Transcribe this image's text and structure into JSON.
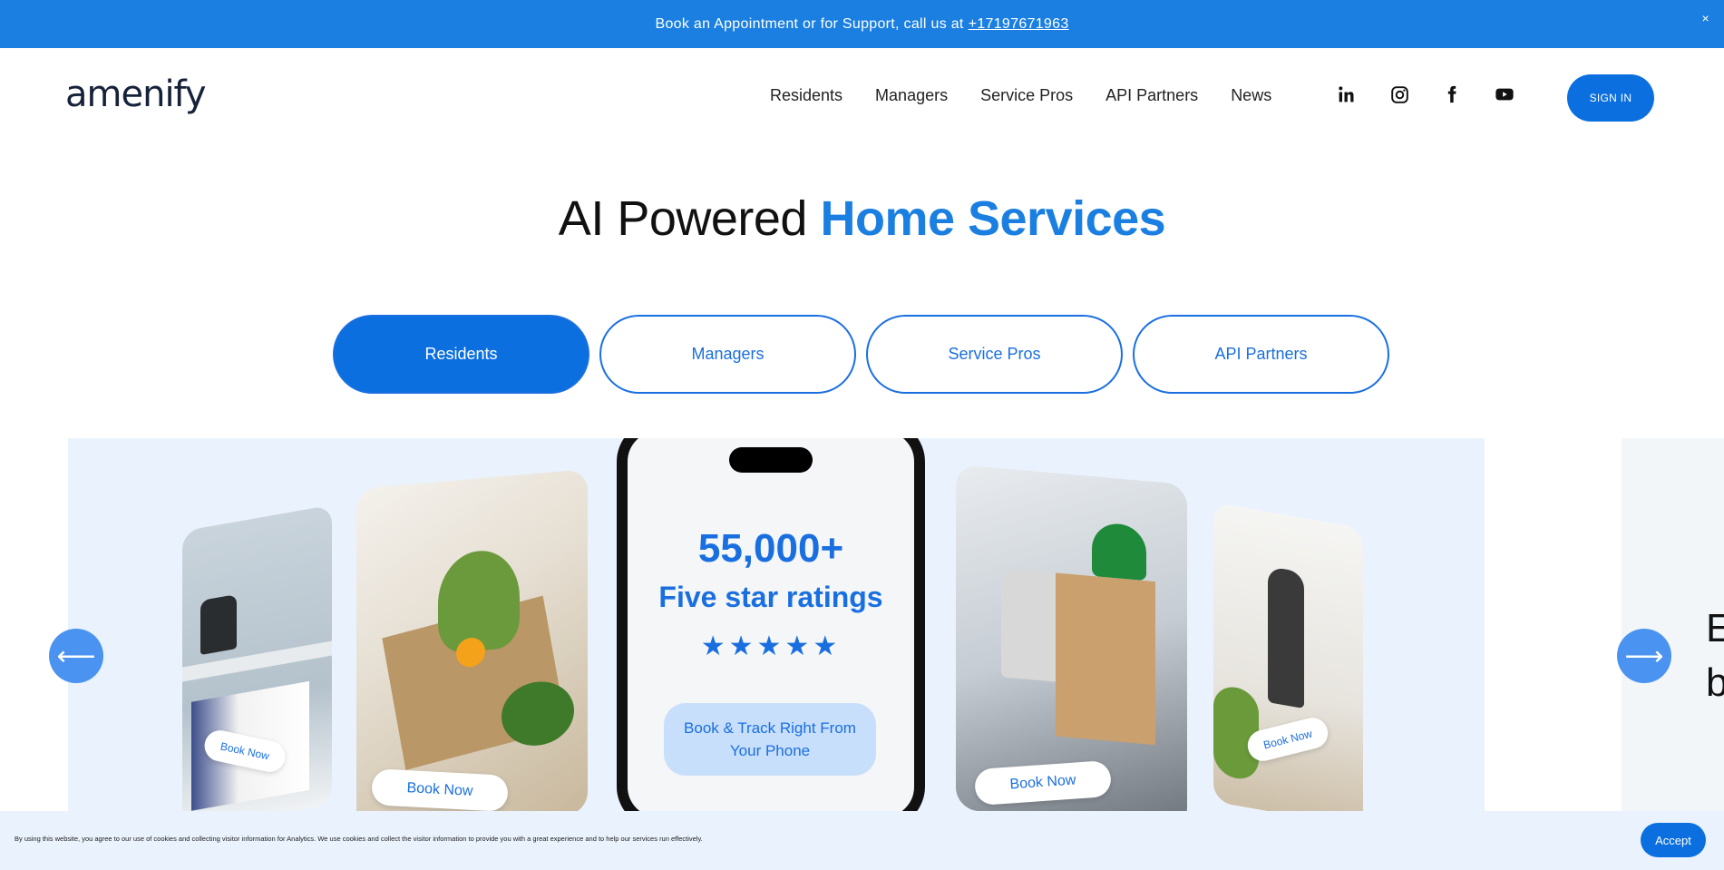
{
  "announcement": {
    "text": "Book an Appointment or for Support, call us at",
    "phone": "+17197671963",
    "close": "×"
  },
  "header": {
    "logo": "amenify",
    "nav": [
      "Residents",
      "Managers",
      "Service Pros",
      "API Partners",
      "News"
    ],
    "social_icons": [
      "linkedin-icon",
      "instagram-icon",
      "facebook-icon",
      "youtube-icon"
    ],
    "signin": "SIGN IN"
  },
  "hero": {
    "title_plain": "AI Powered",
    "title_accent": "Home Services"
  },
  "tabs": [
    {
      "label": "Residents",
      "active": true
    },
    {
      "label": "Managers",
      "active": false
    },
    {
      "label": "Service Pros",
      "active": false
    },
    {
      "label": "API Partners",
      "active": false
    }
  ],
  "carousel": {
    "cards": [
      {
        "book_label": "Book Now"
      },
      {
        "book_label": "Book Now"
      },
      {
        "book_label": "Book Now"
      },
      {
        "book_label": "Book Now"
      }
    ],
    "phone": {
      "stat_number": "55,000+",
      "stat_label": "Five star ratings",
      "stars": "★★★★★",
      "cta": "Book & Track Right From Your Phone"
    },
    "prev_arrow": "⟵",
    "next_arrow": "⟶",
    "peek_text": "E b"
  },
  "cookie": {
    "text": "By using this website, you agree to our use of cookies and collecting visitor information for Analytics. We use cookies and collect the visitor information to provide you with a great experience and to help our services run effectively.",
    "accept": "Accept"
  },
  "colors": {
    "primary": "#1a7fe0",
    "button": "#0b6fe0",
    "carousel_bg": "#eaf3fd"
  }
}
